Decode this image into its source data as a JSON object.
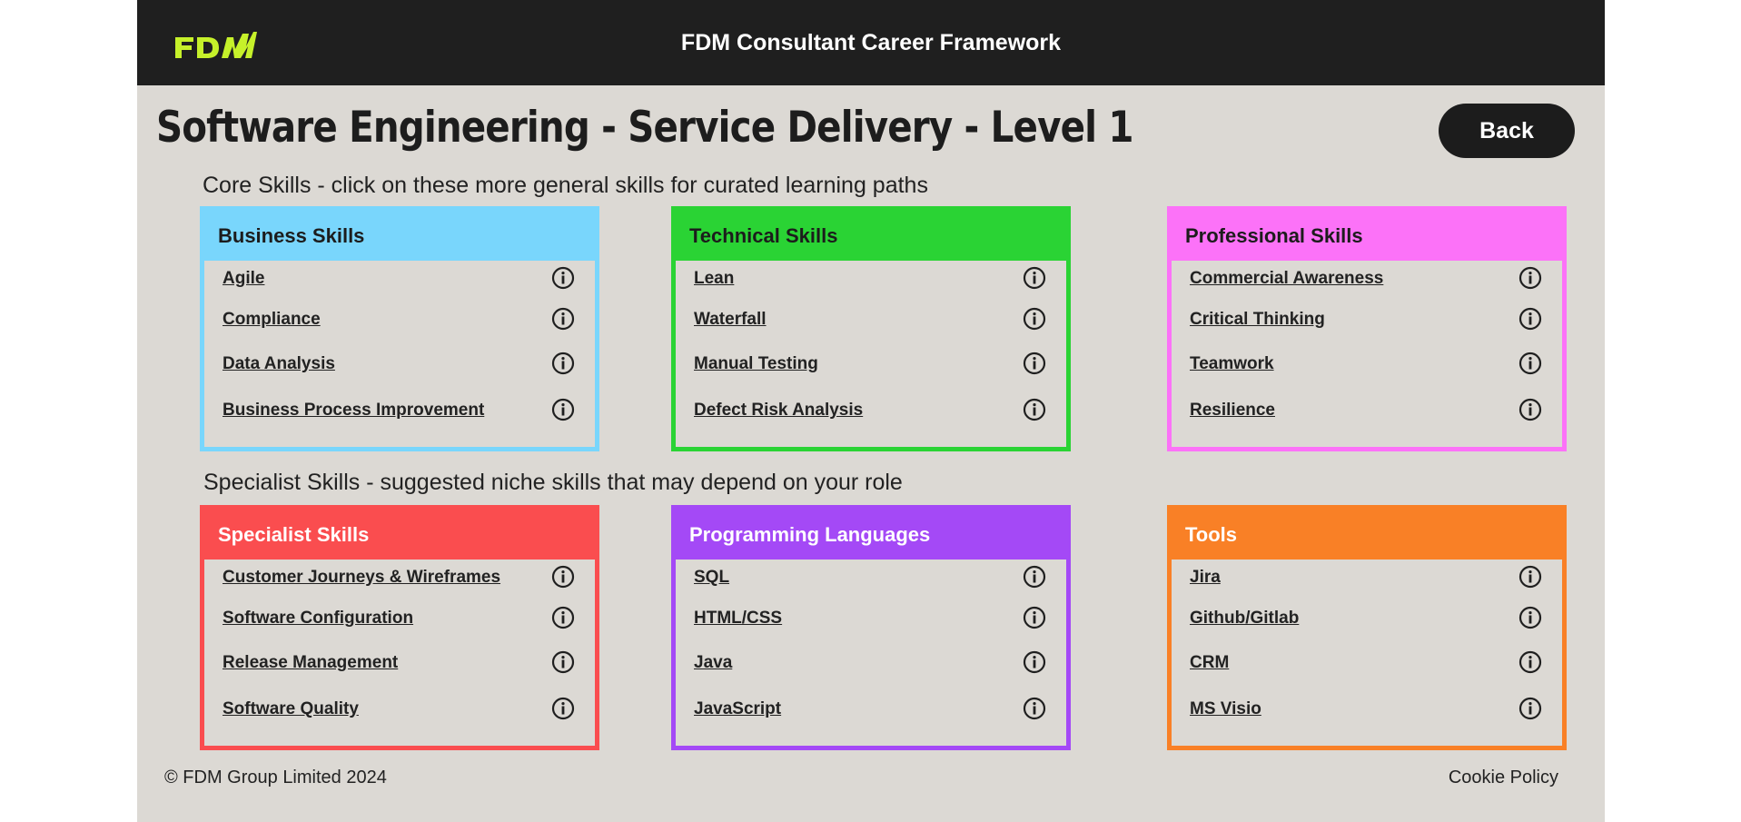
{
  "header": {
    "logo_text": "FDM",
    "app_title": "FDM Consultant Career Framework"
  },
  "page": {
    "title": "Software Engineering - Service Delivery - Level 1",
    "back_label": "Back"
  },
  "core_section": {
    "heading": "Core Skills - click on these more general skills for curated learning paths"
  },
  "specialist_section": {
    "heading": "Specialist Skills - suggested niche skills that may depend on your role"
  },
  "cards": [
    {
      "title": "Business Skills",
      "color": "#79d6fc",
      "header_text_color": "#1c1c1c",
      "items": [
        "Agile",
        "Compliance",
        "Data Analysis",
        "Business Process Improvement"
      ]
    },
    {
      "title": "Technical Skills",
      "color": "#2ad334",
      "header_text_color": "#1c1c1c",
      "items": [
        "Lean",
        "Waterfall",
        "Manual Testing",
        "Defect Risk Analysis"
      ]
    },
    {
      "title": "Professional Skills",
      "color": "#fc72f8",
      "header_text_color": "#1c1c1c",
      "items": [
        "Commercial Awareness",
        "Critical Thinking",
        "Teamwork",
        "Resilience"
      ]
    },
    {
      "title": "Specialist Skills",
      "color": "#fa4d4f",
      "header_text_color": "#ffffff",
      "items": [
        "Customer Journeys & Wireframes",
        "Software Configuration",
        "Release Management",
        "Software Quality"
      ]
    },
    {
      "title": "Programming Languages",
      "color": "#a449f6",
      "header_text_color": "#ffffff",
      "items": [
        "SQL",
        "HTML/CSS",
        "Java",
        "JavaScript"
      ]
    },
    {
      "title": "Tools",
      "color": "#f98026",
      "header_text_color": "#ffffff",
      "items": [
        "Jira",
        "Github/Gitlab",
        "CRM",
        "MS Visio"
      ]
    }
  ],
  "icons": {
    "logo": "fdm-logo",
    "info": "info-circle-icon"
  },
  "footer": {
    "copyright": "© FDM Group Limited 2024",
    "cookie_label": "Cookie Policy"
  },
  "colors": {
    "background": "#dcd9d4",
    "topbar": "#1f1f1f",
    "logo": "#c6f12a"
  }
}
